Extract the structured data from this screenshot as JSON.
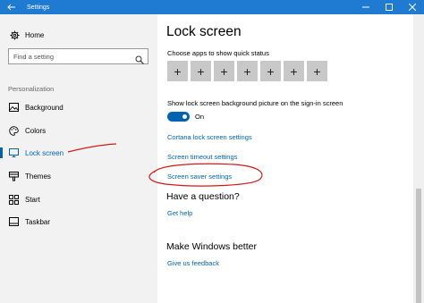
{
  "window": {
    "title": "Settings"
  },
  "sidebar": {
    "home_label": "Home",
    "search_placeholder": "Find a setting",
    "section_label": "Personalization",
    "items": [
      {
        "label": "Background",
        "icon": "picture-icon"
      },
      {
        "label": "Colors",
        "icon": "palette-icon"
      },
      {
        "label": "Lock screen",
        "icon": "monitor-icon",
        "active": true
      },
      {
        "label": "Themes",
        "icon": "brush-icon"
      },
      {
        "label": "Start",
        "icon": "start-icon"
      },
      {
        "label": "Taskbar",
        "icon": "taskbar-icon"
      }
    ]
  },
  "main": {
    "title": "Lock screen",
    "quick_status_label": "Choose apps to show quick status",
    "quick_status_tiles": [
      "+",
      "+",
      "+",
      "+",
      "+",
      "+",
      "+"
    ],
    "background_signin_label": "Show lock screen background picture on the sign-in screen",
    "toggle_state": "On",
    "links": {
      "cortana": "Cortana lock screen settings",
      "screen_timeout": "Screen timeout settings",
      "screen_saver": "Screen saver settings"
    },
    "question_heading": "Have a question?",
    "get_help": "Get help",
    "better_heading": "Make Windows better",
    "feedback": "Give us feedback"
  },
  "colors": {
    "titlebar": "#1f7ad1",
    "accent": "#0063b1",
    "annotation": "#d11a1a"
  }
}
